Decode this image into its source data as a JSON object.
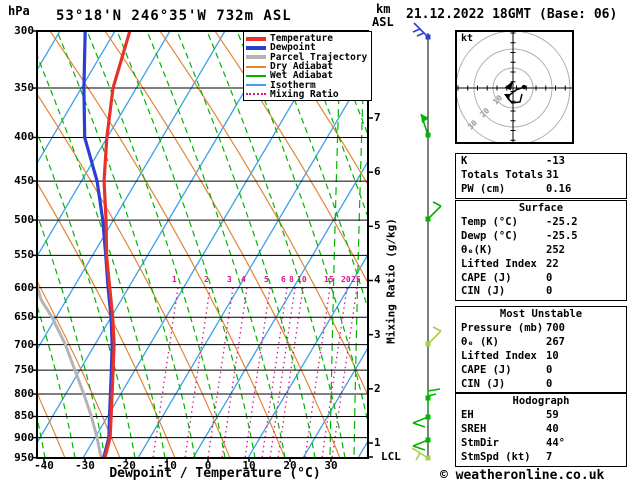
{
  "header": {
    "pressure_unit": "hPa",
    "station_title": "53°18'N 246°35'W 732m ASL",
    "alt_unit_line1": "km",
    "alt_unit_line2": "ASL",
    "datetime": "21.12.2022 18GMT (Base: 06)"
  },
  "legend": {
    "items": [
      {
        "label": "Temperature",
        "color": "#e63229",
        "thick": true,
        "dotted": false
      },
      {
        "label": "Dewpoint",
        "color": "#2a3fd4",
        "thick": true,
        "dotted": false
      },
      {
        "label": "Parcel Trajectory",
        "color": "#b4b4b4",
        "thick": true,
        "dotted": false
      },
      {
        "label": "Dry Adiabat",
        "color": "#e0873a",
        "thick": false,
        "dotted": false
      },
      {
        "label": "Wet Adiabat",
        "color": "#00b400",
        "thick": false,
        "dotted": false
      },
      {
        "label": "Isotherm",
        "color": "#3da0e8",
        "thick": false,
        "dotted": false
      },
      {
        "label": "Mixing Ratio",
        "color": "#d8158c",
        "thick": false,
        "dotted": true
      }
    ]
  },
  "axes": {
    "pressure_ticks": [
      300,
      350,
      400,
      450,
      500,
      550,
      600,
      650,
      700,
      750,
      800,
      850,
      900,
      950
    ],
    "temp_ticks": [
      -40,
      -30,
      -20,
      -10,
      0,
      10,
      20,
      30
    ],
    "km_ticks": [
      1,
      2,
      3,
      4,
      5,
      6,
      7
    ],
    "lcl_label": "LCL",
    "xaxis_title": "Dewpoint / Temperature (°C)",
    "mixing_axis_title": "Mixing Ratio (g/kg)"
  },
  "chart_data": {
    "type": "skewt-sounding",
    "pressure_range_hpa": [
      300,
      950
    ],
    "temp_axis_range_c": [
      -40,
      30
    ],
    "temperature_profile": [
      [
        300,
        -80.5
      ],
      [
        350,
        -76.4
      ],
      [
        400,
        -70.8
      ],
      [
        450,
        -65.2
      ],
      [
        500,
        -59.1
      ],
      [
        550,
        -53.9
      ],
      [
        600,
        -48.5
      ],
      [
        650,
        -43.5
      ],
      [
        700,
        -39.2
      ],
      [
        750,
        -35.8
      ],
      [
        800,
        -32.6
      ],
      [
        850,
        -29.6
      ],
      [
        900,
        -26.8
      ],
      [
        950,
        -25.2
      ]
    ],
    "dewpoint_profile": [
      [
        300,
        -91.4
      ],
      [
        350,
        -83.5
      ],
      [
        400,
        -76.2
      ],
      [
        450,
        -66.9
      ],
      [
        500,
        -59.9
      ],
      [
        550,
        -54.1
      ],
      [
        600,
        -48.9
      ],
      [
        650,
        -43.9
      ],
      [
        700,
        -39.7
      ],
      [
        750,
        -36.2
      ],
      [
        800,
        -33.0
      ],
      [
        850,
        -30.0
      ],
      [
        900,
        -27.1
      ],
      [
        950,
        -25.5
      ]
    ],
    "parcel_profile": [
      [
        950,
        -26.1
      ],
      [
        900,
        -30.0
      ],
      [
        850,
        -34.4
      ],
      [
        800,
        -39.5
      ],
      [
        750,
        -45.1
      ],
      [
        700,
        -51.1
      ],
      [
        650,
        -58.3
      ],
      [
        620,
        -63.5
      ],
      [
        600,
        -66.1
      ]
    ],
    "mixing_ratio_lines": [
      [
        1,
        178
      ],
      [
        2,
        210
      ],
      [
        3,
        233
      ],
      [
        4,
        247
      ],
      [
        5,
        270
      ],
      [
        6,
        287
      ],
      [
        8,
        295
      ],
      [
        10,
        303
      ],
      [
        15,
        330
      ],
      [
        20,
        347
      ],
      [
        25,
        357
      ]
    ],
    "colors": {
      "temperature": "#e63229",
      "dewpoint": "#2a3fd4",
      "parcel": "#b4b4b4",
      "dry_adiabat": "#e0873a",
      "wet_adiabat": "#00b400",
      "isotherm": "#3da0e8",
      "mixing_ratio": "#d8158c",
      "grid": "#000000"
    }
  },
  "hodograph": {
    "unit_label": "kt",
    "ring_labels": [
      "10",
      "20",
      "30"
    ],
    "trace_kt": [
      [
        5.6,
        0.5
      ],
      [
        1.5,
        -1.0
      ],
      [
        -3.1,
        -4.6
      ],
      [
        -0.5,
        -7.7
      ],
      [
        3.6,
        -7.2
      ],
      [
        4.6,
        -3.1
      ]
    ]
  },
  "wind_barbs": [
    {
      "km": 8.5,
      "color": "#2a3fd4",
      "kind": "nw-ticks"
    },
    {
      "km": 6.69,
      "color": "#00b400",
      "kind": "nw-pennant"
    },
    {
      "km": 5.13,
      "color": "#00b400",
      "kind": "ne-tick"
    },
    {
      "km": 2.83,
      "color": "#a8cf4a",
      "kind": "ne-tick"
    },
    {
      "km": 1.83,
      "color": "#00b400",
      "kind": "right-ticks"
    },
    {
      "km": 1.48,
      "color": "#00b400",
      "kind": "sw-zigzag"
    },
    {
      "km": 1.06,
      "color": "#00b400",
      "kind": "sw-zigzag"
    },
    {
      "km": 0.72,
      "color": "#a8cf4a",
      "kind": "sw-tick"
    }
  ],
  "panel": {
    "boxes": [
      {
        "header": null,
        "rows": [
          [
            "K",
            "-13"
          ],
          [
            "Totals Totals",
            "31"
          ],
          [
            "PW (cm)",
            "0.16"
          ]
        ]
      },
      {
        "header": "Surface",
        "rows": [
          [
            "Temp (°C)",
            "-25.2"
          ],
          [
            "Dewp (°C)",
            "-25.5"
          ],
          [
            "θₑ(K)",
            "252"
          ],
          [
            "Lifted Index",
            "22"
          ],
          [
            "CAPE (J)",
            "0"
          ],
          [
            "CIN (J)",
            "0"
          ]
        ]
      },
      {
        "header": "Most Unstable",
        "rows": [
          [
            "Pressure (mb)",
            "700"
          ],
          [
            "θₑ (K)",
            "267"
          ],
          [
            "Lifted Index",
            "10"
          ],
          [
            "CAPE (J)",
            "0"
          ],
          [
            "CIN (J)",
            "0"
          ]
        ]
      },
      {
        "header": "Hodograph",
        "rows": [
          [
            "EH",
            "59"
          ],
          [
            "SREH",
            "40"
          ],
          [
            "StmDir",
            "44°"
          ],
          [
            "StmSpd (kt)",
            "7"
          ]
        ]
      }
    ]
  },
  "footer": {
    "copyright": "© weatheronline.co.uk"
  }
}
